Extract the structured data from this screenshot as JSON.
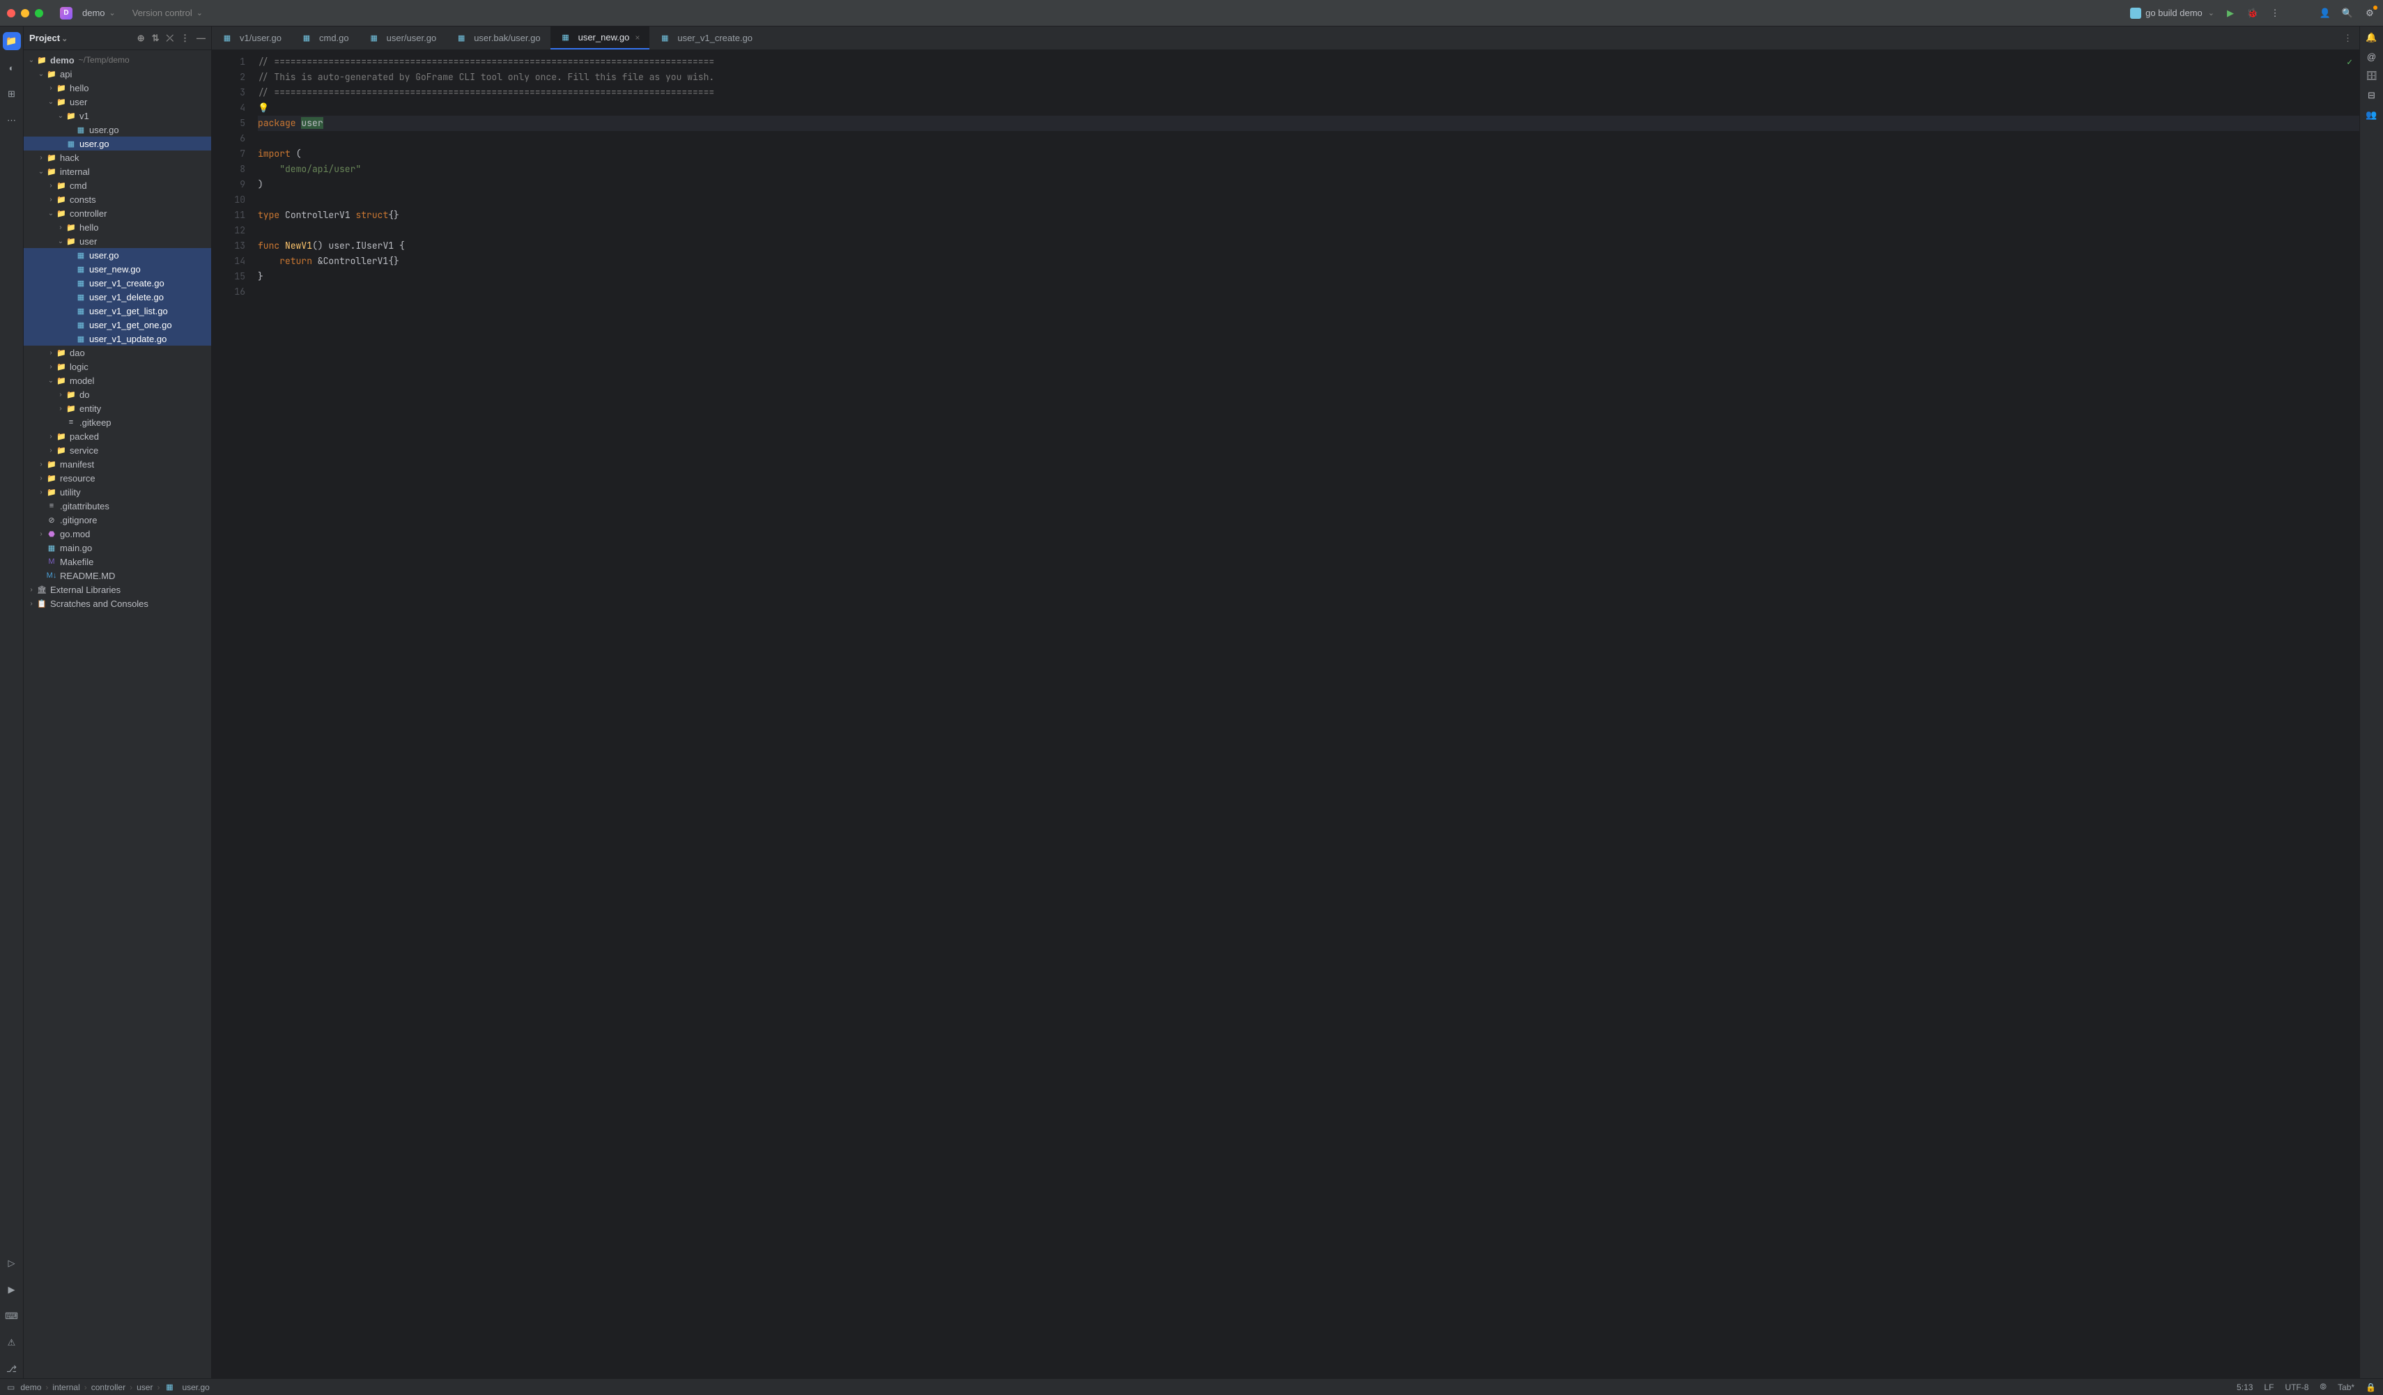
{
  "window": {
    "project_badge": "D",
    "project_name": "demo",
    "vcs_menu": "Version control"
  },
  "run": {
    "config_label": "go build demo"
  },
  "project_panel": {
    "title": "Project"
  },
  "tree": {
    "root": {
      "name": "demo",
      "path": "~/Temp/demo"
    },
    "api": "api",
    "hello": "hello",
    "user": "user",
    "v1": "v1",
    "v1_user_go": "user.go",
    "api_user_user_go": "user.go",
    "hack": "hack",
    "internal": "internal",
    "cmd": "cmd",
    "consts": "consts",
    "controller": "controller",
    "ctrl_hello": "hello",
    "ctrl_user": "user",
    "ctrl_user_go": "user.go",
    "ctrl_user_new": "user_new.go",
    "ctrl_user_v1_create": "user_v1_create.go",
    "ctrl_user_v1_delete": "user_v1_delete.go",
    "ctrl_user_v1_get_list": "user_v1_get_list.go",
    "ctrl_user_v1_get_one": "user_v1_get_one.go",
    "ctrl_user_v1_update": "user_v1_update.go",
    "dao": "dao",
    "logic": "logic",
    "model": "model",
    "do": "do",
    "entity": "entity",
    "gitkeep": ".gitkeep",
    "packed": "packed",
    "service": "service",
    "manifest": "manifest",
    "resource": "resource",
    "utility": "utility",
    "gitattributes": ".gitattributes",
    "gitignore": ".gitignore",
    "gomod": "go.mod",
    "main": "main.go",
    "makefile": "Makefile",
    "readme": "README.MD",
    "ext_libs": "External Libraries",
    "scratches": "Scratches and Consoles"
  },
  "tabs": [
    {
      "label": "v1/user.go"
    },
    {
      "label": "cmd.go"
    },
    {
      "label": "user/user.go"
    },
    {
      "label": "user.bak/user.go"
    },
    {
      "label": "user_new.go",
      "active": true,
      "closeable": true
    },
    {
      "label": "user_v1_create.go"
    }
  ],
  "code": {
    "lines": [
      "// =================================================================================",
      "// This is auto-generated by GoFrame CLI tool only once. Fill this file as you wish.",
      "// =================================================================================",
      "",
      "package user",
      "",
      "import (",
      "    \"demo/api/user\"",
      ")",
      "",
      "type ControllerV1 struct{}",
      "",
      "func NewV1() user.IUserV1 {",
      "    return &ControllerV1{}",
      "}",
      ""
    ]
  },
  "breadcrumbs": [
    "demo",
    "internal",
    "controller",
    "user",
    "user.go"
  ],
  "status": {
    "caret": "5:13",
    "eol": "LF",
    "encoding": "UTF-8",
    "indent": "Tab*"
  }
}
